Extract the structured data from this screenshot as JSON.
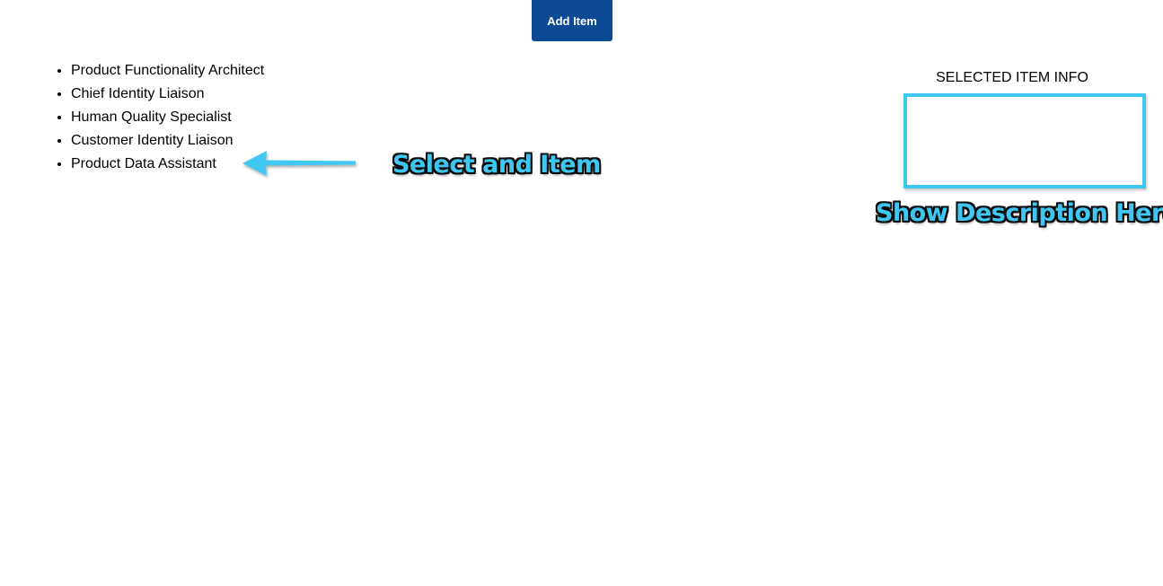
{
  "toolbar": {
    "add_label": "Add Item"
  },
  "items": [
    {
      "label": "Product Functionality Architect"
    },
    {
      "label": "Chief Identity Liaison"
    },
    {
      "label": "Human Quality Specialist"
    },
    {
      "label": "Customer Identity Liaison"
    },
    {
      "label": "Product Data Assistant"
    }
  ],
  "info": {
    "title": "SELECTED ITEM INFO",
    "description": ""
  },
  "annotations": {
    "select": "Select and Item",
    "description": "Show Description Here"
  },
  "colors": {
    "button": "#0d4a96",
    "annotation": "#3fc7f2"
  },
  "icons": {
    "arrow": "arrow-left-icon"
  }
}
